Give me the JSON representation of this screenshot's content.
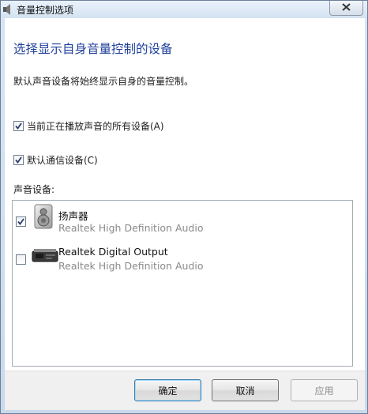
{
  "window": {
    "title": "音量控制选项",
    "close_icon": "close-icon"
  },
  "main": {
    "heading": "选择显示自身音量控制的设备",
    "description": "默认声音设备将始终显示自身的音量控制。",
    "options": [
      {
        "label": "当前正在播放声音的所有设备(A)",
        "checked": true
      },
      {
        "label": "默认通信设备(C)",
        "checked": true
      }
    ],
    "devices_label": "声音设备:",
    "devices": [
      {
        "name": "扬声器",
        "driver": "Realtek High Definition Audio",
        "checked": true,
        "icon": "speaker-icon"
      },
      {
        "name": "Realtek Digital Output",
        "driver": "Realtek High Definition Audio",
        "checked": false,
        "icon": "digital-output-icon"
      }
    ]
  },
  "buttons": {
    "ok": "确定",
    "cancel": "取消",
    "apply": "应用"
  }
}
